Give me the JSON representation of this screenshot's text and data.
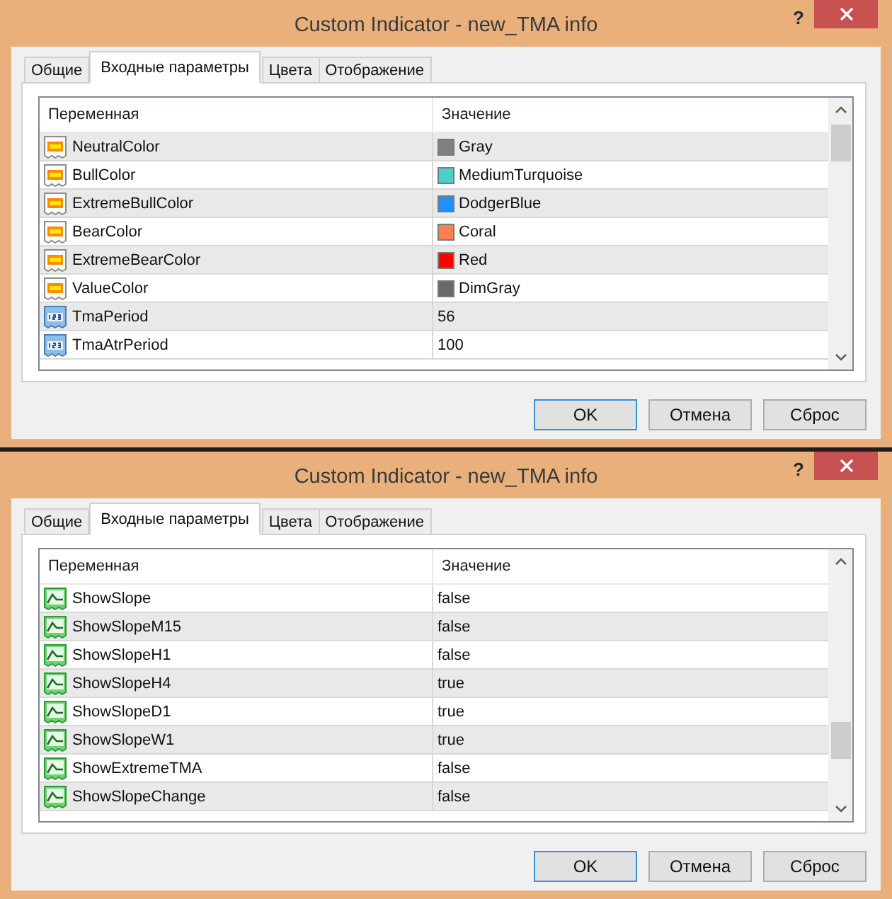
{
  "windows": [
    {
      "title": "Custom Indicator - new_TMA info",
      "help": "?",
      "tabs": [
        {
          "label": "Общие",
          "selected": false
        },
        {
          "label": "Входные параметры",
          "selected": true
        },
        {
          "label": "Цвета",
          "selected": false
        },
        {
          "label": "Отображение",
          "selected": false
        }
      ],
      "table": {
        "columns": [
          "Переменная",
          "Значение"
        ],
        "scrolled": false,
        "rows": [
          {
            "kind": "color",
            "name": "NeutralColor",
            "value": "Gray",
            "color": "#808080",
            "shaded": true
          },
          {
            "kind": "color",
            "name": "BullColor",
            "value": "MediumTurquoise",
            "color": "#48d1cc",
            "shaded": false
          },
          {
            "kind": "color",
            "name": "ExtremeBullColor",
            "value": "DodgerBlue",
            "color": "#1e90ff",
            "shaded": true
          },
          {
            "kind": "color",
            "name": "BearColor",
            "value": "Coral",
            "color": "#ff7f50",
            "shaded": false
          },
          {
            "kind": "color",
            "name": "ExtremeBearColor",
            "value": "Red",
            "color": "#ff0000",
            "shaded": true
          },
          {
            "kind": "color",
            "name": "ValueColor",
            "value": "DimGray",
            "color": "#696969",
            "shaded": false
          },
          {
            "kind": "int",
            "name": "TmaPeriod",
            "value": "56",
            "shaded": true
          },
          {
            "kind": "int",
            "name": "TmaAtrPeriod",
            "value": "100",
            "shaded": false
          }
        ]
      },
      "buttons": [
        {
          "label": "OK",
          "default": true
        },
        {
          "label": "Отмена",
          "default": false
        },
        {
          "label": "Сброс",
          "default": false
        }
      ]
    },
    {
      "title": "Custom Indicator - new_TMA info",
      "help": "?",
      "tabs": [
        {
          "label": "Общие",
          "selected": false
        },
        {
          "label": "Входные параметры",
          "selected": true
        },
        {
          "label": "Цвета",
          "selected": false
        },
        {
          "label": "Отображение",
          "selected": false
        }
      ],
      "table": {
        "columns": [
          "Переменная",
          "Значение"
        ],
        "scrolled": true,
        "rows": [
          {
            "kind": "bool",
            "name": "ShowSlope",
            "value": "false",
            "shaded": false
          },
          {
            "kind": "bool",
            "name": "ShowSlopeM15",
            "value": "false",
            "shaded": true
          },
          {
            "kind": "bool",
            "name": "ShowSlopeH1",
            "value": "false",
            "shaded": false
          },
          {
            "kind": "bool",
            "name": "ShowSlopeH4",
            "value": "true",
            "shaded": true
          },
          {
            "kind": "bool",
            "name": "ShowSlopeD1",
            "value": "true",
            "shaded": false
          },
          {
            "kind": "bool",
            "name": "ShowSlopeW1",
            "value": "true",
            "shaded": true
          },
          {
            "kind": "bool",
            "name": "ShowExtremeTMA",
            "value": "false",
            "shaded": false
          },
          {
            "kind": "bool",
            "name": "ShowSlopeChange",
            "value": "false",
            "shaded": true
          }
        ]
      },
      "buttons": [
        {
          "label": "OK",
          "default": true
        },
        {
          "label": "Отмена",
          "default": false
        },
        {
          "label": "Сброс",
          "default": false
        }
      ]
    }
  ]
}
